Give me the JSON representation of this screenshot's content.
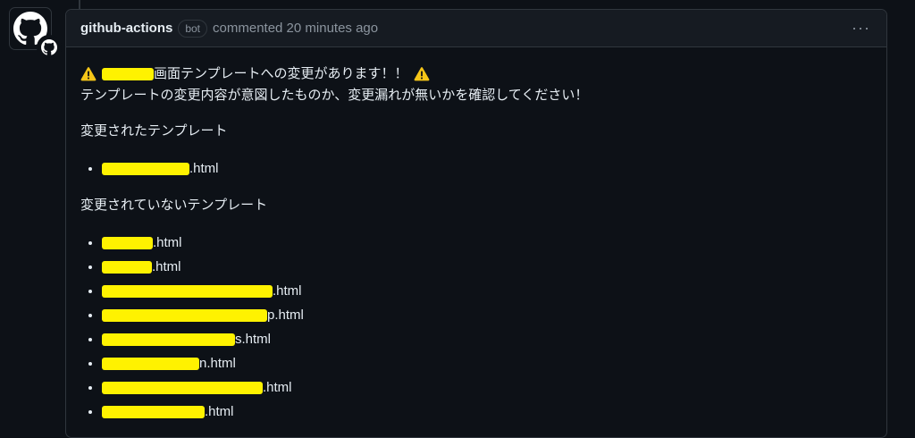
{
  "comment": {
    "author": "github-actions",
    "bot_label": "bot",
    "meta": "commented 20 minutes ago",
    "more_label": "···",
    "heading_after_redact": "画面テンプレートへの変更があります！！",
    "subtext": "テンプレートの変更内容が意図したものか、変更漏れが無いかを確認してください！",
    "changed_heading": "変更されたテンプレート",
    "changed_items": [
      ".html"
    ],
    "unchanged_heading": "変更されていないテンプレート",
    "unchanged_items": [
      ".html",
      ".html",
      ".html",
      "p.html",
      "s.html",
      "n.html",
      ".html",
      ".html"
    ]
  },
  "colors": {
    "background": "#0d1117",
    "header_bg": "#161b22",
    "border": "#30363d",
    "muted_text": "#8b949e",
    "text": "#e6edf3",
    "redaction": "#fff200",
    "warning": "#d29922"
  },
  "icons": {
    "avatar": "github-octocat-icon",
    "warning": "warning-triangle-icon",
    "more": "kebab-horizontal-icon"
  }
}
